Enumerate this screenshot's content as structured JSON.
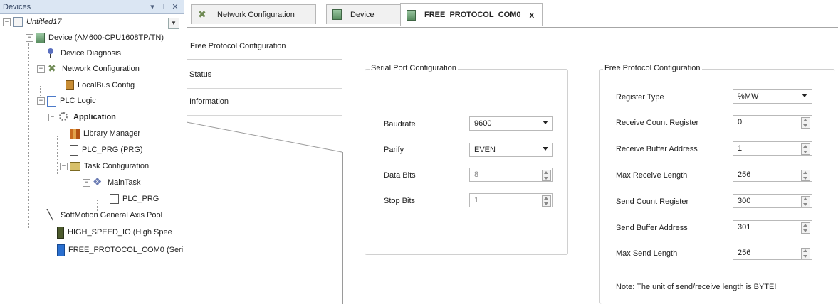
{
  "devices_panel": {
    "title": "Devices",
    "controls": {
      "dropdown": "▾",
      "pin": "⊥",
      "close": "✕"
    },
    "scroll_glyph": "▼",
    "tree": [
      {
        "label": "Untitled17",
        "icon": "project-icon",
        "style": "italic",
        "expander": "−"
      },
      {
        "label": "Device (AM600-CPU1608TP/TN)",
        "icon": "device-icon",
        "expander": "−"
      },
      {
        "label": "Device Diagnosis",
        "icon": "diagnosis-icon"
      },
      {
        "label": "Network Configuration",
        "icon": "network-config-icon",
        "expander": "−"
      },
      {
        "label": "LocalBus Config",
        "icon": "localbus-icon"
      },
      {
        "label": "PLC Logic",
        "icon": "plc-logic-icon",
        "expander": "−"
      },
      {
        "label": "Application",
        "icon": "application-icon",
        "style": "bold",
        "expander": "−"
      },
      {
        "label": "Library Manager",
        "icon": "library-manager-icon"
      },
      {
        "label": "PLC_PRG (PRG)",
        "icon": "program-icon"
      },
      {
        "label": "Task Configuration",
        "icon": "task-config-icon",
        "expander": "−"
      },
      {
        "label": "MainTask",
        "icon": "main-task-icon",
        "expander": "−"
      },
      {
        "label": "PLC_PRG",
        "icon": "program-call-icon"
      },
      {
        "label": "SoftMotion General Axis Pool",
        "icon": "softmotion-icon"
      },
      {
        "label": "HIGH_SPEED_IO (High Spee",
        "icon": "high-speed-io-icon"
      },
      {
        "label": "FREE_PROTOCOL_COM0 (Seri",
        "icon": "free-protocol-icon"
      }
    ]
  },
  "editor_tabs": [
    {
      "label": "Network Configuration",
      "icon": "network-config-icon"
    },
    {
      "label": "Device",
      "icon": "device-icon"
    },
    {
      "label": "FREE_PROTOCOL_COM0",
      "icon": "device-icon",
      "active": true,
      "close": "x"
    }
  ],
  "side_tabs": [
    {
      "label": "Free Protocol Configuration",
      "active": true
    },
    {
      "label": "Status"
    },
    {
      "label": "Information"
    }
  ],
  "serial_port": {
    "title": "Serial Port Configuration",
    "baudrate_label": "Baudrate",
    "baudrate_value": "9600",
    "parity_label": "Parify",
    "parity_value": "EVEN",
    "data_bits_label": "Data Bits",
    "data_bits_value": "8",
    "stop_bits_label": "Stop Bits",
    "stop_bits_value": "1"
  },
  "free_protocol": {
    "title": "Free Protocol Configuration",
    "register_type_label": "Register Type",
    "register_type_value": "%MW",
    "receive_count_label": "Receive Count Register",
    "receive_count_value": "0",
    "receive_buffer_label": "Receive Buffer Address",
    "receive_buffer_value": "1",
    "max_receive_label": "Max Receive Length",
    "max_receive_value": "256",
    "send_count_label": "Send Count Register",
    "send_count_value": "300",
    "send_buffer_label": "Send Buffer Address",
    "send_buffer_value": "301",
    "max_send_label": "Max Send Length",
    "max_send_value": "256",
    "note": "Note: The unit of send/receive length is BYTE!"
  }
}
